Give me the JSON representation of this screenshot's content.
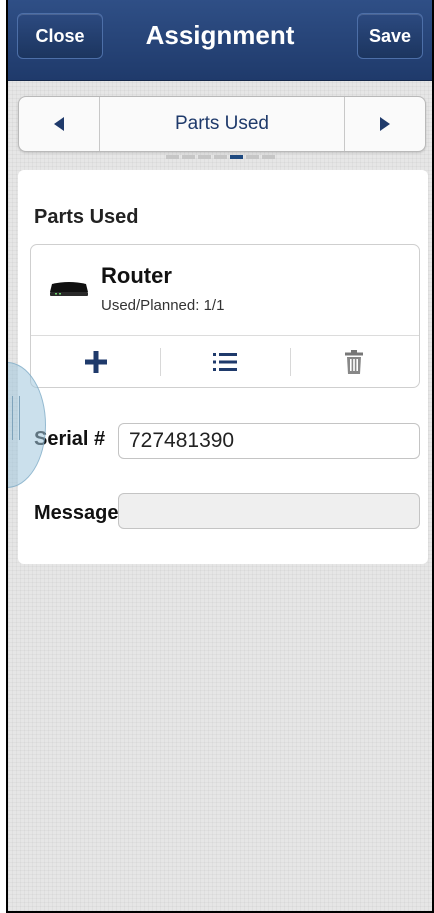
{
  "header": {
    "close_label": "Close",
    "title": "Assignment",
    "save_label": "Save"
  },
  "nav": {
    "prev_icon": "left-arrow-icon",
    "label": "Parts Used",
    "next_icon": "right-arrow-icon",
    "page_count": 7,
    "active_page": 5
  },
  "parts_section": {
    "title": "Parts Used",
    "part": {
      "icon": "router-icon",
      "name": "Router",
      "used_planned": "Used/Planned: 1/1"
    },
    "actions": {
      "add_icon": "plus-icon",
      "list_icon": "list-icon",
      "delete_icon": "trash-icon"
    }
  },
  "fields": {
    "serial_label": "Serial #",
    "serial_value": "727481390",
    "message_label": "Message",
    "message_value": ""
  },
  "colors": {
    "header_bg": "#1f3a6b",
    "accent": "#1f3a6b",
    "active_dot": "#1f4a80"
  }
}
